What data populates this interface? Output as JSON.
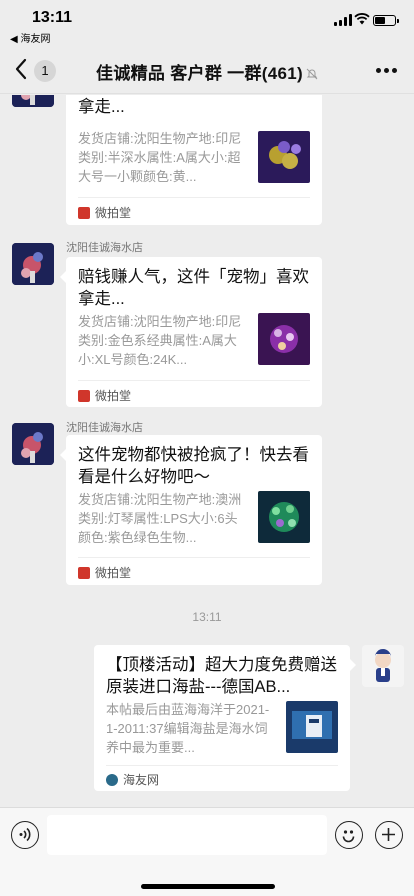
{
  "status_bar": {
    "time": "13:11",
    "back_app": "◀ 海友网"
  },
  "nav": {
    "unread_count": "1",
    "title": "佳诚精品 客户群 一群(461)"
  },
  "messages": [
    {
      "sender": "",
      "title": "赔钱赚人气，这件「宠物」喜欢拿走...",
      "desc": "发货店铺:沈阳生物产地:印尼类别:半深水属性:A属大小:超大号一小颗颜色:黄...",
      "source": "微拍堂"
    },
    {
      "sender": "沈阳佳诚海水店",
      "title": "赔钱赚人气，这件「宠物」喜欢拿走...",
      "desc": "发货店铺:沈阳生物产地:印尼类别:金色系经典属性:A属大小:XL号颜色:24K...",
      "source": "微拍堂"
    },
    {
      "sender": "沈阳佳诚海水店",
      "title": "这件宠物都快被抢疯了！快去看看是什么好物吧～",
      "desc": "发货店铺:沈阳生物产地:澳洲类别:灯琴属性:LPS大小:6头颜色:紫色绿色生物...",
      "source": "微拍堂"
    }
  ],
  "timestamp": "13:11",
  "own_message": {
    "title": "【顶楼活动】超大力度免费赠送原装进口海盐---德国AB...",
    "desc": "本帖最后由蓝海海洋于2021-1-2011:37编辑海盐是海水饲养中最为重要...",
    "source": "海友网"
  },
  "input": {
    "placeholder": ""
  },
  "colors": {
    "background": "#ededed",
    "card": "#ffffff",
    "source_icon_weipaitang": "#d0362b",
    "source_icon_haiyouwang": "#2a6a8a"
  }
}
